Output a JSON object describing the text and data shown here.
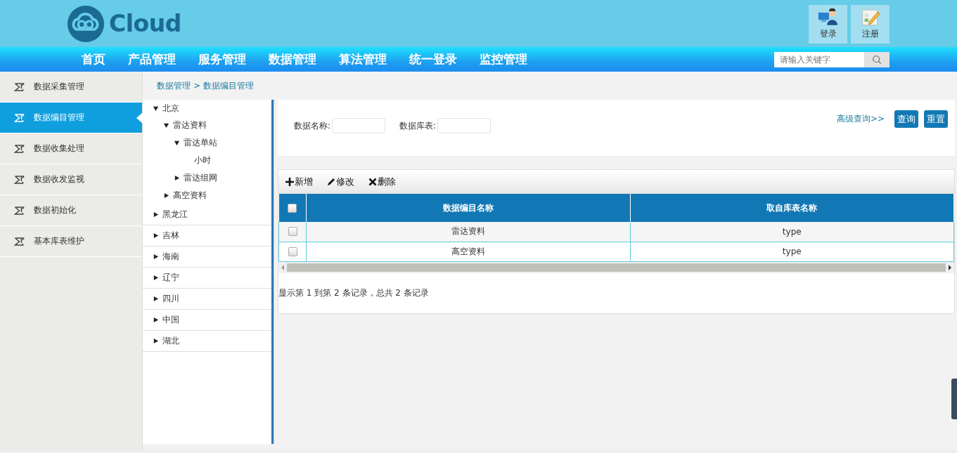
{
  "header": {
    "logo_text": "Cloud",
    "user_buttons": [
      {
        "kind": "login",
        "label": "登录"
      },
      {
        "kind": "register",
        "label": "注册"
      }
    ]
  },
  "nav": {
    "items": [
      {
        "label": "首页"
      },
      {
        "label": "产品管理"
      },
      {
        "label": "服务管理"
      },
      {
        "label": "数据管理"
      },
      {
        "label": "算法管理"
      },
      {
        "label": "统一登录"
      },
      {
        "label": "监控管理"
      }
    ],
    "search": {
      "placeholder": "请输入关键字"
    }
  },
  "sidebar": {
    "items": [
      {
        "label": "数据采集管理",
        "selected": false
      },
      {
        "label": "数据编目管理",
        "selected": true
      },
      {
        "label": "数据收集处理",
        "selected": false
      },
      {
        "label": "数据收发监视",
        "selected": false
      },
      {
        "label": "数据初始化",
        "selected": false
      },
      {
        "label": "基本库表维护",
        "selected": false
      }
    ]
  },
  "breadcrumb": [
    {
      "label": "数据管理"
    },
    {
      "label": ">"
    },
    {
      "label": "数据编目管理"
    }
  ],
  "tree": [
    {
      "label": "北京",
      "expanded": true,
      "children": [
        {
          "label": "雷达资料",
          "expanded": true,
          "children": [
            {
              "label": "雷达单站",
              "expanded": true,
              "children": [
                {
                  "label": "小时"
                }
              ]
            },
            {
              "label": "雷达组网",
              "expanded": false
            }
          ]
        },
        {
          "label": "高空资料",
          "expanded": false
        }
      ]
    },
    {
      "label": "黑龙江",
      "expanded": false
    },
    {
      "label": "吉林",
      "expanded": false
    },
    {
      "label": "海南",
      "expanded": false
    },
    {
      "label": "辽宁",
      "expanded": false
    },
    {
      "label": "四川",
      "expanded": false
    },
    {
      "label": "中国",
      "expanded": false
    },
    {
      "label": "湖北",
      "expanded": false
    }
  ],
  "filters": {
    "fields": [
      {
        "label": "数据名称:"
      },
      {
        "label": "数据库表:"
      }
    ],
    "advanced_link": "高级查询>>",
    "buttons": [
      {
        "label": "查询"
      },
      {
        "label": "重置"
      }
    ]
  },
  "toolbar": [
    {
      "kind": "add",
      "label": "新增"
    },
    {
      "kind": "edit",
      "label": "修改"
    },
    {
      "kind": "delete",
      "label": "删除"
    }
  ],
  "table": {
    "header_checked": false,
    "columns": [
      "数据编目名称",
      "取自库表名称"
    ],
    "rows": [
      {
        "checked": false,
        "cells": [
          "雷达资料",
          "type"
        ]
      },
      {
        "checked": false,
        "cells": [
          "高空资料",
          "type"
        ]
      }
    ]
  },
  "pagination_text": "显示第 1 到第 2 条记录，总共 2 条记录"
}
